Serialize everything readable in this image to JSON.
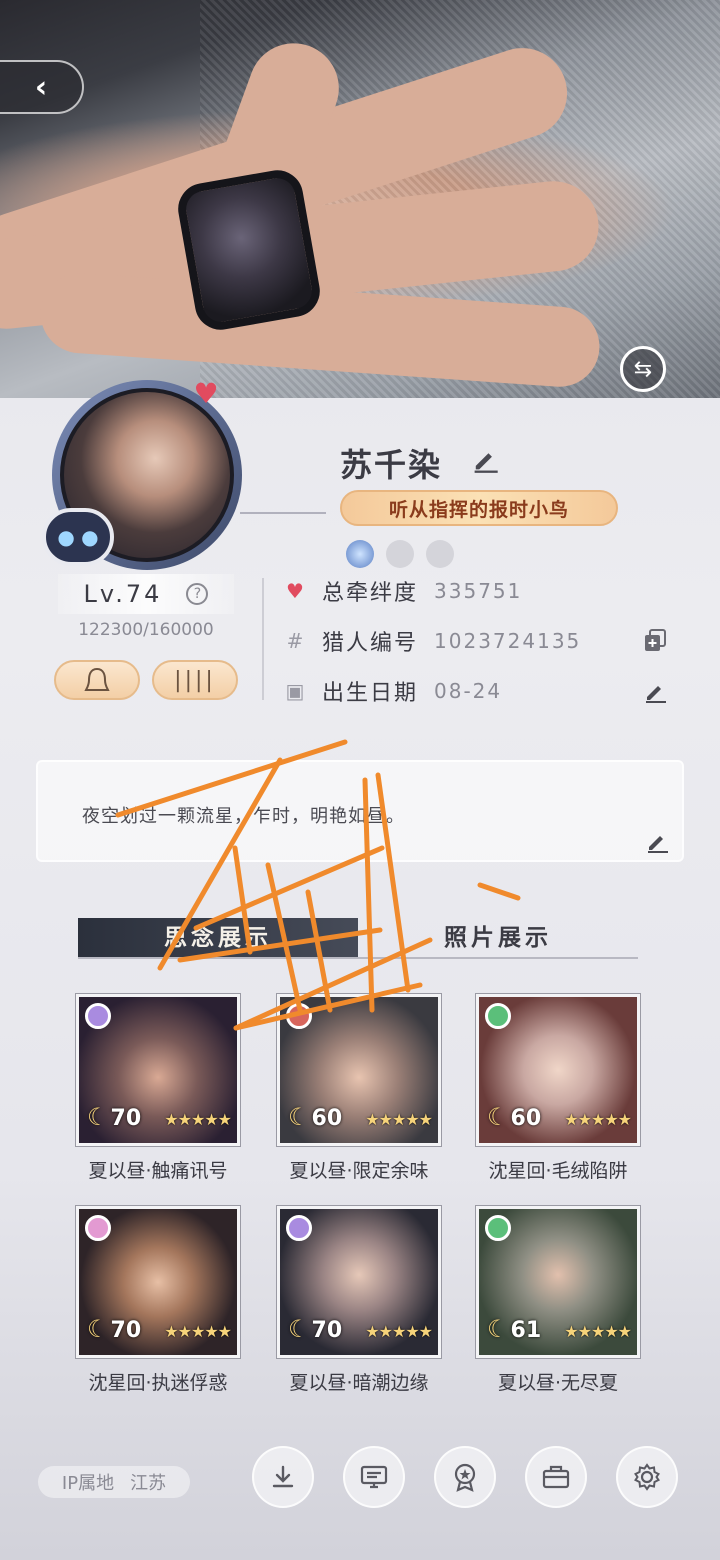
{
  "profile": {
    "name": "苏千染",
    "title_badge": "听从指挥的报时小鸟",
    "level": "Lv.74",
    "exp": "122300/160000"
  },
  "stats": [
    {
      "icon": "heart-icon",
      "label": "总牵绊度",
      "value": "335751"
    },
    {
      "icon": "hash-icon",
      "label": "猎人编号",
      "value": "1023724135"
    },
    {
      "icon": "cake-icon",
      "label": "出生日期",
      "value": "08-24"
    }
  ],
  "signature": "夜空划过一颗流星，乍时，明艳如昼。",
  "tabs": [
    {
      "label": "思念展示"
    },
    {
      "label": "照片展示"
    }
  ],
  "cards": [
    {
      "name": "夏以昼·触痛讯号",
      "level": "70",
      "gem_color": "#a98be0"
    },
    {
      "name": "夏以昼·限定余味",
      "level": "60",
      "gem_color": "#d7655c"
    },
    {
      "name": "沈星回·毛绒陷阱",
      "level": "60",
      "gem_color": "#5bbf7a"
    },
    {
      "name": "沈星回·执迷俘惑",
      "level": "70",
      "gem_color": "#e39ad2"
    },
    {
      "name": "夏以昼·暗潮边缘",
      "level": "70",
      "gem_color": "#a98be0"
    },
    {
      "name": "夏以昼·无尽夏",
      "level": "61",
      "gem_color": "#5bbf7a"
    }
  ],
  "ip": {
    "label": "IP属地",
    "value": "江苏"
  },
  "bottom_buttons": [
    "download-icon",
    "message-board-icon",
    "medal-icon",
    "briefcase-icon",
    "gear-icon"
  ],
  "colors": {
    "accent_heart": "#e14b5f",
    "tab_active_bg": "#2b303c",
    "badge_gold": "#f4c99a",
    "scribble": "#f08a2c"
  }
}
